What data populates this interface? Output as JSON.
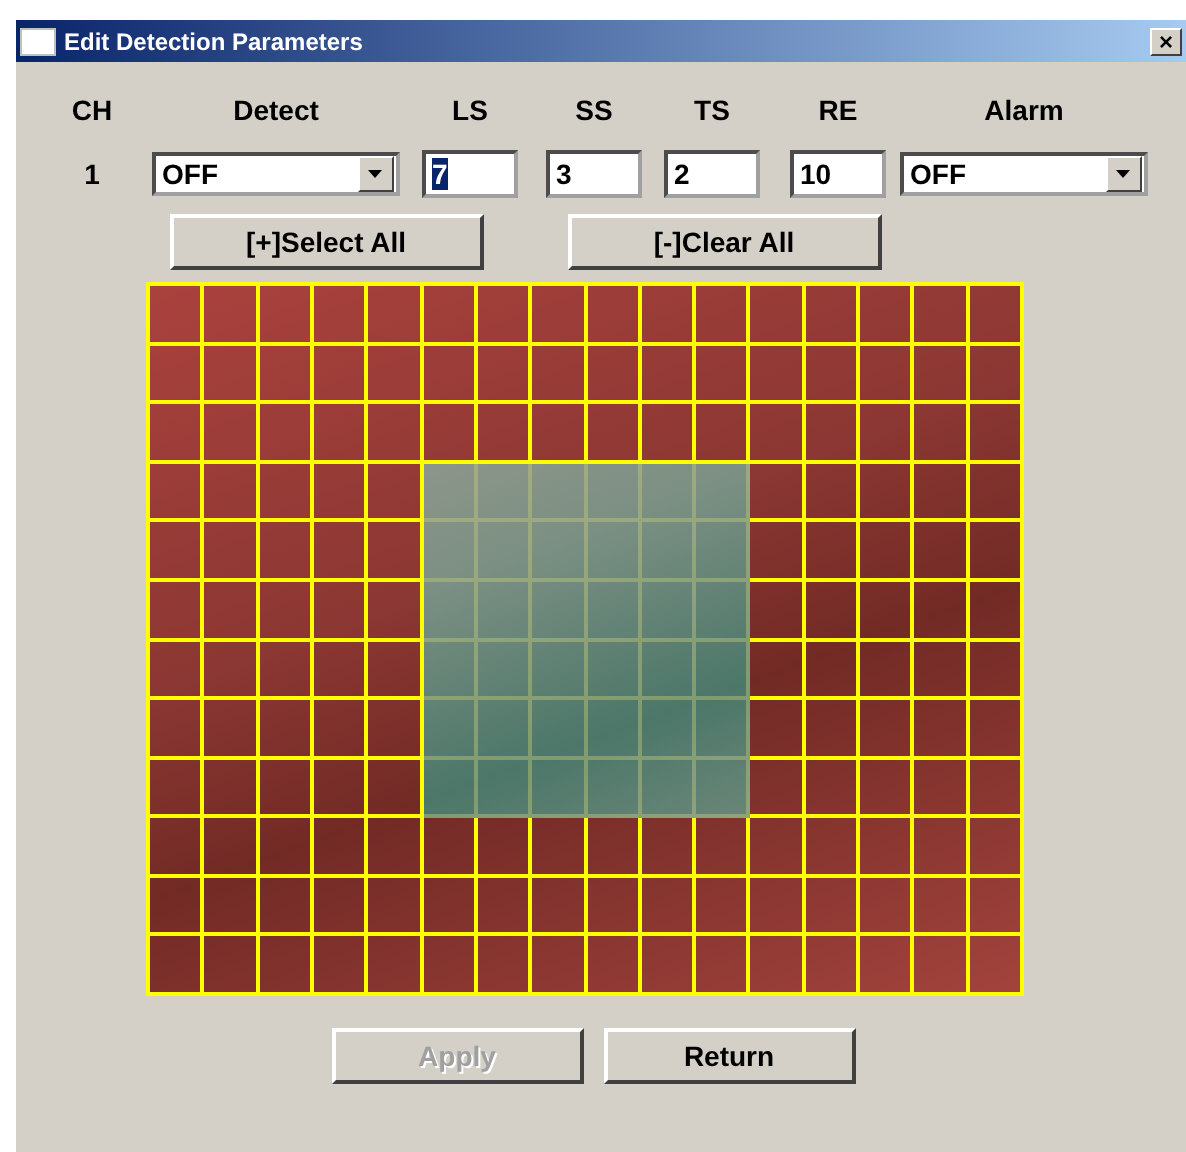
{
  "window": {
    "title": "Edit Detection Parameters",
    "close": "×"
  },
  "columns": [
    "CH",
    "Detect",
    "LS",
    "SS",
    "TS",
    "RE",
    "Alarm"
  ],
  "row": {
    "channel": "1",
    "detect": "OFF",
    "ls": "7",
    "ss": "3",
    "ts": "2",
    "re": "10",
    "alarm": "OFF"
  },
  "select_all": "[+]Select All",
  "clear_all": "[-]Clear All",
  "grid": [
    [
      true,
      true,
      true,
      true,
      true,
      true,
      true,
      true,
      true,
      true,
      true,
      true,
      true,
      true,
      true,
      true
    ],
    [
      true,
      true,
      true,
      true,
      true,
      true,
      true,
      true,
      true,
      true,
      true,
      true,
      true,
      true,
      true,
      true
    ],
    [
      true,
      true,
      true,
      true,
      true,
      true,
      true,
      true,
      true,
      true,
      true,
      true,
      true,
      true,
      true,
      true
    ],
    [
      true,
      true,
      true,
      true,
      true,
      false,
      false,
      false,
      false,
      false,
      false,
      true,
      true,
      true,
      true,
      true
    ],
    [
      true,
      true,
      true,
      true,
      true,
      false,
      false,
      false,
      false,
      false,
      false,
      true,
      true,
      true,
      true,
      true
    ],
    [
      true,
      true,
      true,
      true,
      true,
      false,
      false,
      false,
      false,
      false,
      false,
      true,
      true,
      true,
      true,
      true
    ],
    [
      true,
      true,
      true,
      true,
      true,
      false,
      false,
      false,
      false,
      false,
      false,
      true,
      true,
      true,
      true,
      true
    ],
    [
      true,
      true,
      true,
      true,
      true,
      false,
      false,
      false,
      false,
      false,
      false,
      true,
      true,
      true,
      true,
      true
    ],
    [
      true,
      true,
      true,
      true,
      true,
      false,
      false,
      false,
      false,
      false,
      false,
      true,
      true,
      true,
      true,
      true
    ],
    [
      true,
      true,
      true,
      true,
      true,
      true,
      true,
      true,
      true,
      true,
      true,
      true,
      true,
      true,
      true,
      true
    ],
    [
      true,
      true,
      true,
      true,
      true,
      true,
      true,
      true,
      true,
      true,
      true,
      true,
      true,
      true,
      true,
      true
    ],
    [
      true,
      true,
      true,
      true,
      true,
      true,
      true,
      true,
      true,
      true,
      true,
      true,
      true,
      true,
      true,
      true
    ]
  ],
  "buttons": [
    {
      "label": "Apply",
      "disabled": true
    },
    {
      "label": "Return",
      "disabled": false
    }
  ]
}
